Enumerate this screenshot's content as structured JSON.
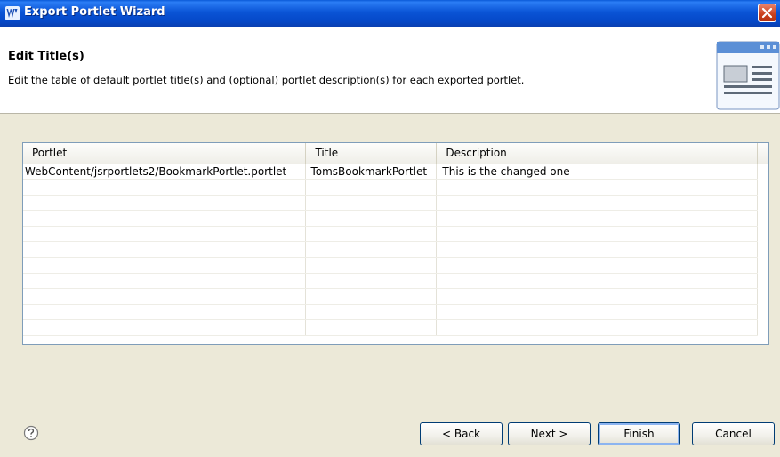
{
  "window": {
    "title": "Export Portlet Wizard",
    "icons": {
      "app": "websphere-w-icon",
      "close": "close-icon"
    }
  },
  "header": {
    "title": "Edit Title(s)",
    "description": "Edit the table of default portlet title(s) and (optional) portlet description(s) for each exported portlet.",
    "banner_icon": "portlet-window-icon"
  },
  "table": {
    "columns": [
      "Portlet",
      "Title",
      "Description"
    ],
    "rows": [
      [
        "WebContent/jsrportlets2/BookmarkPortlet.portlet",
        "TomsBookmarkPortlet",
        "This is the changed one"
      ]
    ]
  },
  "footer": {
    "help_icon": "help-icon",
    "buttons": {
      "back": "< Back",
      "next": "Next >",
      "finish": "Finish",
      "cancel": "Cancel"
    }
  },
  "colors": {
    "titlebar": "#0a54d6",
    "dialog_bg": "#ece9d8",
    "table_border": "#7f9db9"
  }
}
